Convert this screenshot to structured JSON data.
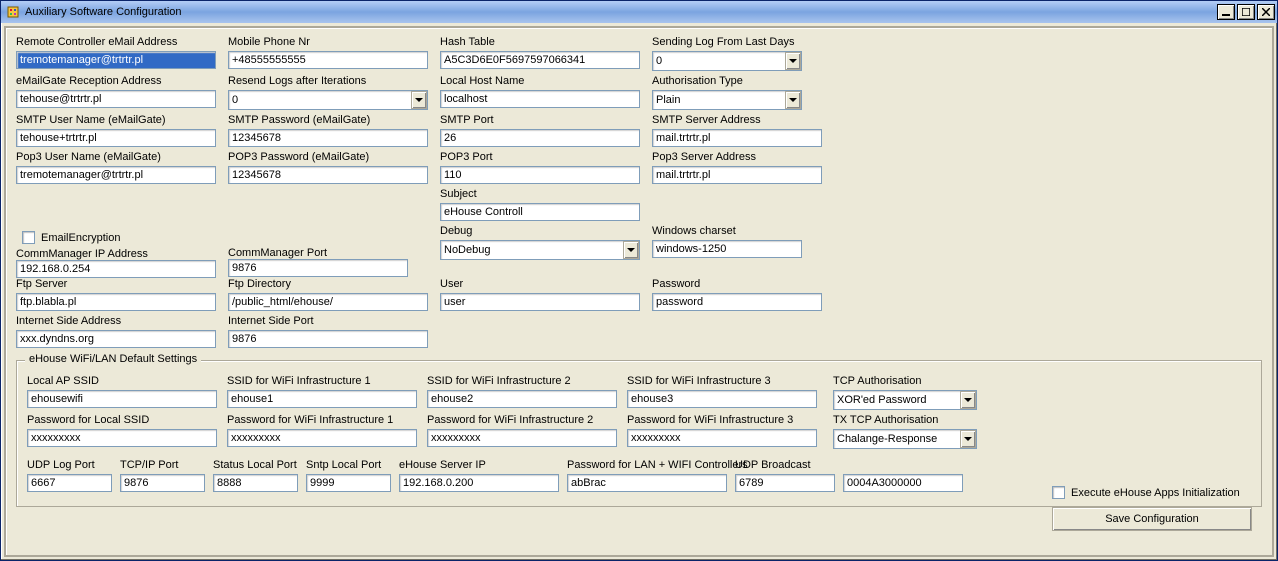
{
  "window": {
    "title": "Auxiliary Software Configuration"
  },
  "labels": {
    "remote_email": "Remote Controller eMail Address",
    "mobile": "Mobile Phone Nr",
    "hash": "Hash Table",
    "send_log_days": "Sending Log From Last Days",
    "emailgate_recv": "eMailGate Reception Address",
    "resend_iter": "Resend Logs after Iterations",
    "local_host": "Local Host Name",
    "auth_type": "Authorisation Type",
    "smtp_user": "SMTP User Name (eMailGate)",
    "smtp_pass": "SMTP Password (eMailGate)",
    "smtp_port": "SMTP Port",
    "smtp_server": "SMTP Server Address",
    "pop3_user": "Pop3 User Name (eMailGate)",
    "pop3_pass": "POP3 Password (eMailGate)",
    "pop3_port": "POP3 Port",
    "pop3_server": "Pop3 Server Address",
    "subject": "Subject",
    "debug": "Debug",
    "win_charset": "Windows charset",
    "email_enc": "EmailEncryption",
    "cm_ip": "CommManager IP Address",
    "cm_port": "CommManager Port",
    "ftp_server": "Ftp Server",
    "ftp_dir": "Ftp Directory",
    "user": "User",
    "password": "Password",
    "inet_addr": "Internet Side Address",
    "inet_port": "Internet Side Port",
    "wifi_group": "eHouse WiFi/LAN Default Settings",
    "local_ssid": "Local AP SSID",
    "ssid1": "SSID for WiFi Infrastructure 1",
    "ssid2": "SSID for WiFi Infrastructure 2",
    "ssid3": "SSID for WiFi Infrastructure 3",
    "tcp_auth": "TCP Authorisation",
    "pass_local": "Password for Local SSID",
    "pass1": "Password for WiFi Infrastructure 1",
    "pass2": "Password for WiFi Infrastructure 2",
    "pass3": "Password for WiFi Infrastructure 3",
    "tx_tcp_auth": "TX TCP Authorisation",
    "udp_log": "UDP Log Port",
    "tcpip_port": "TCP/IP Port",
    "status_port": "Status Local Port",
    "sntp_port": "Sntp Local Port",
    "ehouse_ip": "eHouse Server IP",
    "pass_lan": "Password for LAN + WIFI Controllers",
    "udp_bcast": "UDP Broadcast",
    "exec_init": "Execute eHouse Apps Initialization",
    "save": "Save Configuration"
  },
  "values": {
    "remote_email": "tremotemanager@trtrtr.pl",
    "mobile": "+48555555555",
    "hash": "A5C3D6E0F5697597066341",
    "send_log_days": "0",
    "emailgate_recv": "tehouse@trtrtr.pl",
    "resend_iter": "0",
    "local_host": "localhost",
    "auth_type": "Plain",
    "smtp_user": "tehouse+trtrtr.pl",
    "smtp_pass": "12345678",
    "smtp_port": "26",
    "smtp_server": "mail.trtrtr.pl",
    "pop3_user": "tremotemanager@trtrtr.pl",
    "pop3_pass": "12345678",
    "pop3_port": "110",
    "pop3_server": "mail.trtrtr.pl",
    "subject": "eHouse Controll",
    "debug": "NoDebug",
    "win_charset": "windows-1250",
    "cm_ip": "192.168.0.254",
    "cm_port": "9876",
    "ftp_server": "ftp.blabla.pl",
    "ftp_dir": "/public_html/ehouse/",
    "user": "user",
    "password": "password",
    "inet_addr": "xxx.dyndns.org",
    "inet_port": "9876",
    "local_ssid": "ehousewifi",
    "ssid1": "ehouse1",
    "ssid2": "ehouse2",
    "ssid3": "ehouse3",
    "tcp_auth": "XOR'ed Password",
    "pass_local": "xxxxxxxxx",
    "pass1": "xxxxxxxxx",
    "pass2": "xxxxxxxxx",
    "pass3": "xxxxxxxxx",
    "tx_tcp_auth": "Chalange-Response",
    "udp_log": "6667",
    "tcpip_port": "9876",
    "status_port": "8888",
    "sntp_port": "9999",
    "ehouse_ip": "192.168.0.200",
    "pass_lan": "abBrac",
    "udp_bcast": "6789",
    "mac_prefix": "0004A3000000"
  }
}
